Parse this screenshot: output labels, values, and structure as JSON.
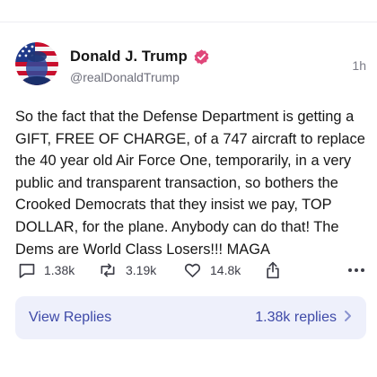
{
  "post": {
    "author": {
      "display_name": "Donald J. Trump",
      "handle": "@realDonaldTrump",
      "verified": true,
      "verified_icon": "verified-badge-icon",
      "verified_color": "#e0477a"
    },
    "timestamp": "1h",
    "text": "So the fact that the Defense Department is getting a GIFT, FREE OF CHARGE, of a 747 aircraft to replace the 40 year old Air Force One, temporarily, in a very public and transparent transaction, so bothers the Crooked Democrats that they insist we pay, TOP DOLLAR, for the plane. Anybody can do that! The Dems are World Class Losers!!! MAGA"
  },
  "actions": {
    "replies": {
      "icon": "reply-icon",
      "count": "1.38k"
    },
    "reposts": {
      "icon": "repost-icon",
      "count": "3.19k"
    },
    "likes": {
      "icon": "heart-icon",
      "count": "14.8k"
    },
    "share": {
      "icon": "share-icon"
    },
    "more": {
      "icon": "more-icon"
    }
  },
  "view_replies": {
    "label": "View Replies",
    "count_text": "1.38k replies",
    "icon": "chevron-right-icon"
  },
  "colors": {
    "accent": "#3e4aa8",
    "replies_bg": "#eef0fb",
    "text": "#161616",
    "muted": "#6e6f7b"
  }
}
